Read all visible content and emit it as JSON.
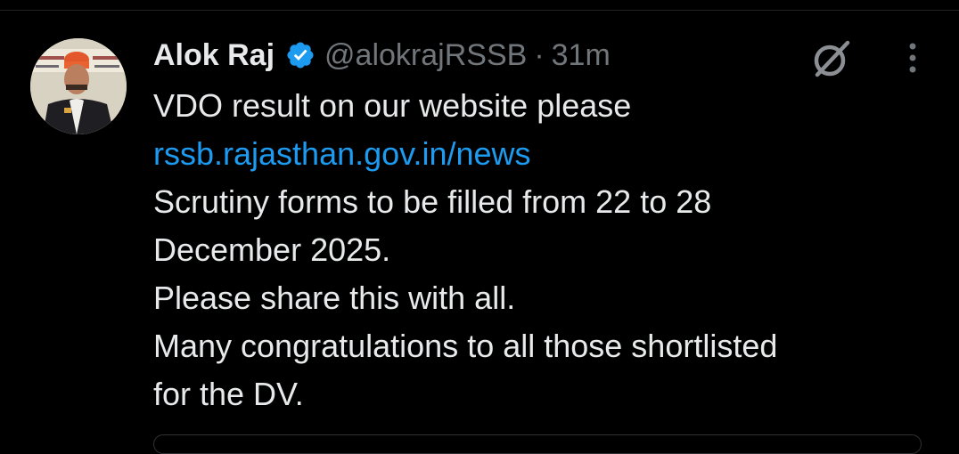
{
  "tweet": {
    "author_name": "Alok Raj",
    "handle": "@alokrajRSSB",
    "separator": "·",
    "timestamp": "31m",
    "lines": [
      "VDO result on our website please",
      "rssb.rajasthan.gov.in/news",
      "Scrutiny forms to be filled from 22 to 28",
      "December 2025.",
      "Please share this with all.",
      "Many congratulations to all those shortlisted",
      "for the DV."
    ]
  },
  "icons": {
    "verified": "verified-badge-icon",
    "grok": "grok-icon",
    "more": "more-options-icon"
  },
  "colors": {
    "background": "#000000",
    "text": "#e7e9ea",
    "muted": "#71767b",
    "link": "#1d9bf0",
    "verified": "#1d9bf0"
  }
}
